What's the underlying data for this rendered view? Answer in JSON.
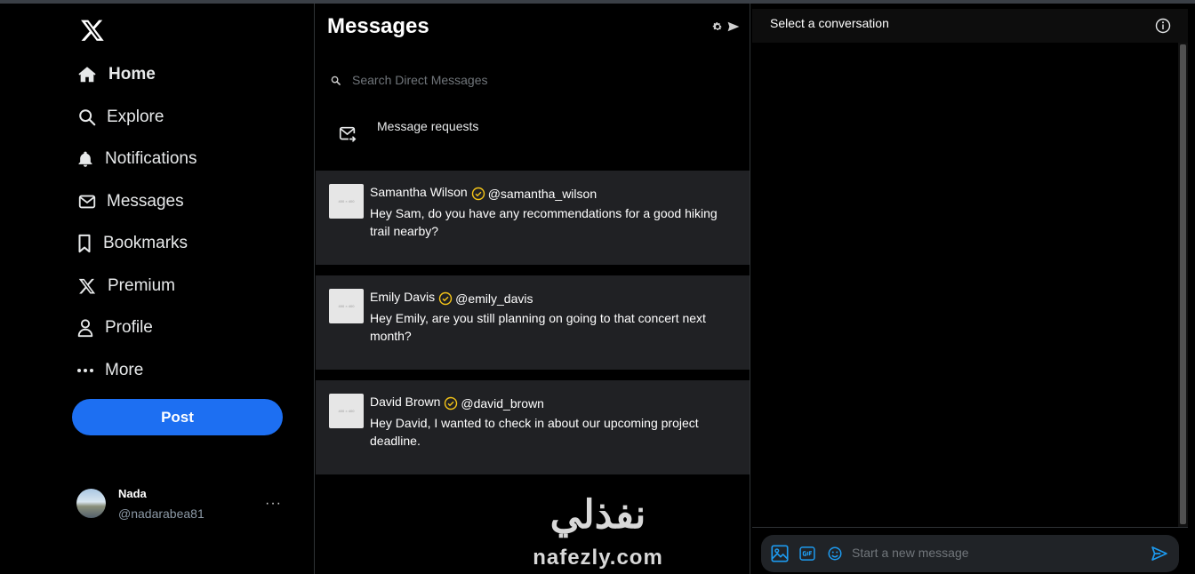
{
  "sidebar": {
    "nav": [
      {
        "label": "Home",
        "icon": "home-icon"
      },
      {
        "label": "Explore",
        "icon": "search-icon"
      },
      {
        "label": "Notifications",
        "icon": "bell-icon"
      },
      {
        "label": "Messages",
        "icon": "envelope-icon"
      },
      {
        "label": "Bookmarks",
        "icon": "bookmark-icon"
      },
      {
        "label": "Premium",
        "icon": "x-logo-icon"
      },
      {
        "label": "Profile",
        "icon": "person-icon"
      },
      {
        "label": "More",
        "icon": "more-dots-icon"
      }
    ],
    "post_label": "Post",
    "account": {
      "name": "Nada",
      "handle": "@nadarabea81",
      "more": "···"
    }
  },
  "messages": {
    "title": "Messages",
    "search_placeholder": "Search Direct Messages",
    "requests_label": "Message requests",
    "conversations": [
      {
        "name": "Samantha Wilson",
        "handle": "@samantha_wilson",
        "preview": "Hey Sam, do you have any recommendations for a good hiking trail nearby?",
        "thumb_text": "400 × 400"
      },
      {
        "name": "Emily Davis",
        "handle": "@emily_davis",
        "preview": "Hey Emily, are you still planning on going to that concert next month?",
        "thumb_text": "400 × 400"
      },
      {
        "name": "David Brown",
        "handle": "@david_brown",
        "preview": "Hey David, I wanted to check in about our upcoming project deadline.",
        "thumb_text": "400 × 400"
      }
    ]
  },
  "panel": {
    "title": "Select a conversation",
    "composer_placeholder": "Start a new message"
  },
  "watermark": {
    "arabic": "نفذلي",
    "latin": "nafezly.com"
  },
  "colors": {
    "accent": "#1d6ff2",
    "verified": "#f5c518",
    "card": "#202124"
  }
}
